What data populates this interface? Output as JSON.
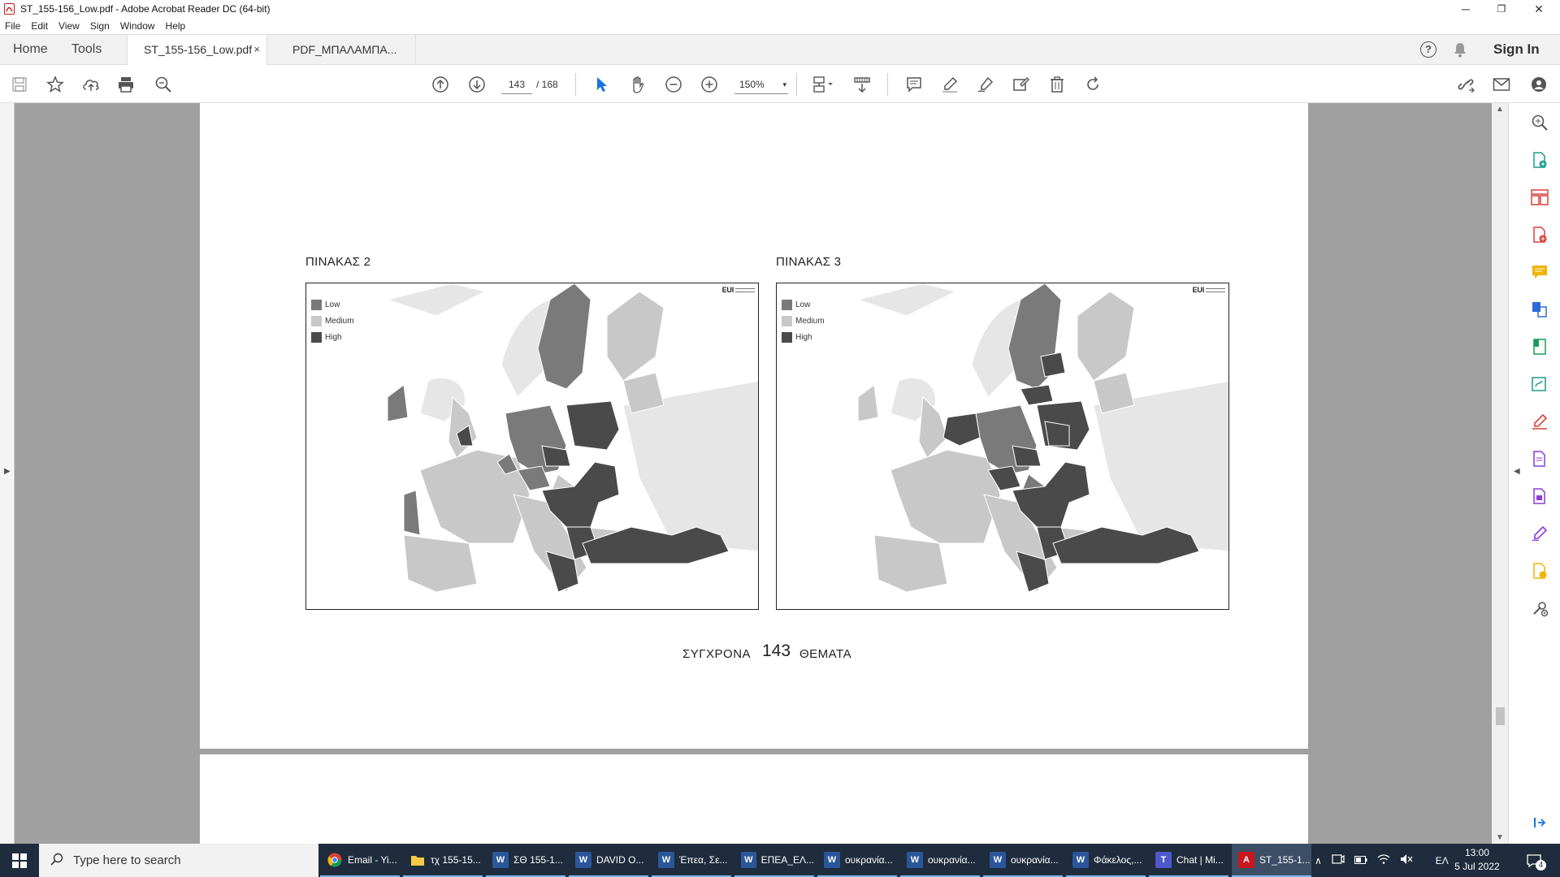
{
  "window": {
    "title": "ST_155-156_Low.pdf - Adobe Acrobat Reader DC (64-bit)",
    "minimize": "─",
    "maximize": "❐",
    "close": "✕"
  },
  "menu": [
    "File",
    "Edit",
    "View",
    "Sign",
    "Window",
    "Help"
  ],
  "tabs": {
    "home": "Home",
    "tools": "Tools",
    "active_doc": "ST_155-156_Low.pdf",
    "close_symbol": "×",
    "other_doc": "PDF_ΜΠΑΛΑΜΠΑ...",
    "help_symbol": "?",
    "signin": "Sign In"
  },
  "toolbar": {
    "page_current": "143",
    "page_total": "/ 168",
    "zoom": "150%",
    "zoom_caret": "▾"
  },
  "document": {
    "figure_left_label": "ΠΙΝΑΚΑΣ 2",
    "figure_right_label": "ΠΙΝΑΚΑΣ 3",
    "legend": [
      {
        "label": "Low",
        "color": "#7a7a7a"
      },
      {
        "label": "Medium",
        "color": "#c8c8c8"
      },
      {
        "label": "High",
        "color": "#4a4a4a"
      }
    ],
    "logo_text": "EUI",
    "footer_left": "ΣΥΓΧΡΟΝΑ",
    "footer_number": "143",
    "footer_right": "ΘΕΜΑΤΑ"
  },
  "colors": {
    "low": "#7a7a7a",
    "medium": "#c8c8c8",
    "high": "#4a4a4a",
    "nodata": "#e6e6e6",
    "taskbar": "#1f2c3d"
  },
  "taskbar": {
    "search_placeholder": "Type here to search",
    "items": [
      {
        "label": "Email - Yi...",
        "icon": "chrome-icon"
      },
      {
        "label": "τχ 155-15...",
        "icon": "folder-icon"
      },
      {
        "label": "ΣΘ 155-1...",
        "icon": "word-icon"
      },
      {
        "label": "DAVID O...",
        "icon": "word-icon"
      },
      {
        "label": "Έπεα, Σε...",
        "icon": "word-icon"
      },
      {
        "label": "ΕΠΕΑ_ΕΛ...",
        "icon": "word-icon"
      },
      {
        "label": "ουκρανία...",
        "icon": "word-icon"
      },
      {
        "label": "ουκρανία...",
        "icon": "word-icon"
      },
      {
        "label": "ουκρανία...",
        "icon": "word-icon"
      },
      {
        "label": "Φάκελος,...",
        "icon": "word-icon"
      },
      {
        "label": "Chat | Mi...",
        "icon": "teams-icon"
      },
      {
        "label": "ST_155-1...",
        "icon": "acrobat-icon"
      }
    ],
    "language": "ΕΛ",
    "time": "13:00",
    "date": "5 Jul 2022",
    "notifications": "4"
  }
}
